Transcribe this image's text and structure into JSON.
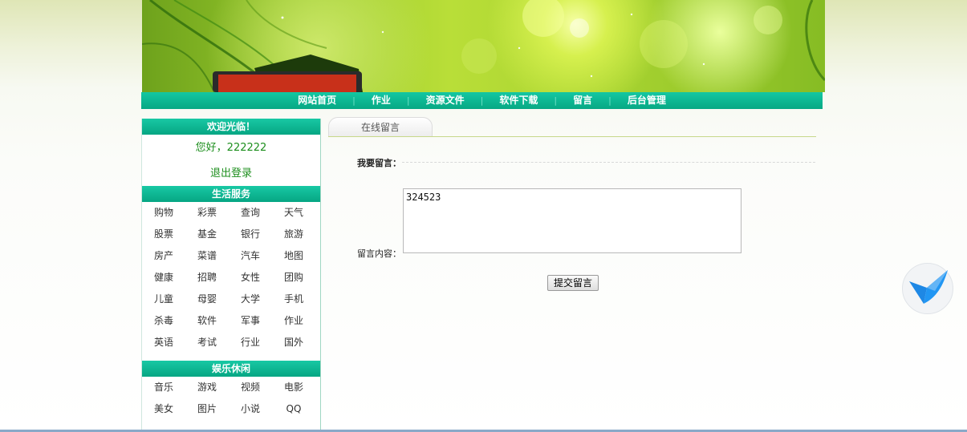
{
  "nav": {
    "items": [
      "网站首页",
      "作业",
      "资源文件",
      "软件下载",
      "留言",
      "后台管理"
    ],
    "separator": "|"
  },
  "sidebar": {
    "welcome_title": "欢迎光临！",
    "greeting": "您好，222222",
    "logout": "退出登录",
    "life_title": "生活服务",
    "life_items": [
      "购物",
      "彩票",
      "查询",
      "天气",
      "股票",
      "基金",
      "银行",
      "旅游",
      "房产",
      "菜谱",
      "汽车",
      "地图",
      "健康",
      "招聘",
      "女性",
      "团购",
      "儿童",
      "母婴",
      "大学",
      "手机",
      "杀毒",
      "软件",
      "军事",
      "作业",
      "英语",
      "考试",
      "行业",
      "国外"
    ],
    "fun_title": "娱乐休闲",
    "fun_items": [
      "音乐",
      "游戏",
      "视频",
      "电影",
      "美女",
      "图片",
      "小说",
      "QQ"
    ]
  },
  "main": {
    "tab_label": "在线留言",
    "my_message_label": "我要留言：",
    "content_label": "留言内容：",
    "message_value": "324523",
    "submit_label": "提交留言"
  },
  "colors": {
    "nav_bg": "#0bb691",
    "link_green": "#1c8e1c",
    "tab_underline": "#c7d88a"
  },
  "icons": {
    "float_badge": "bird-icon"
  }
}
